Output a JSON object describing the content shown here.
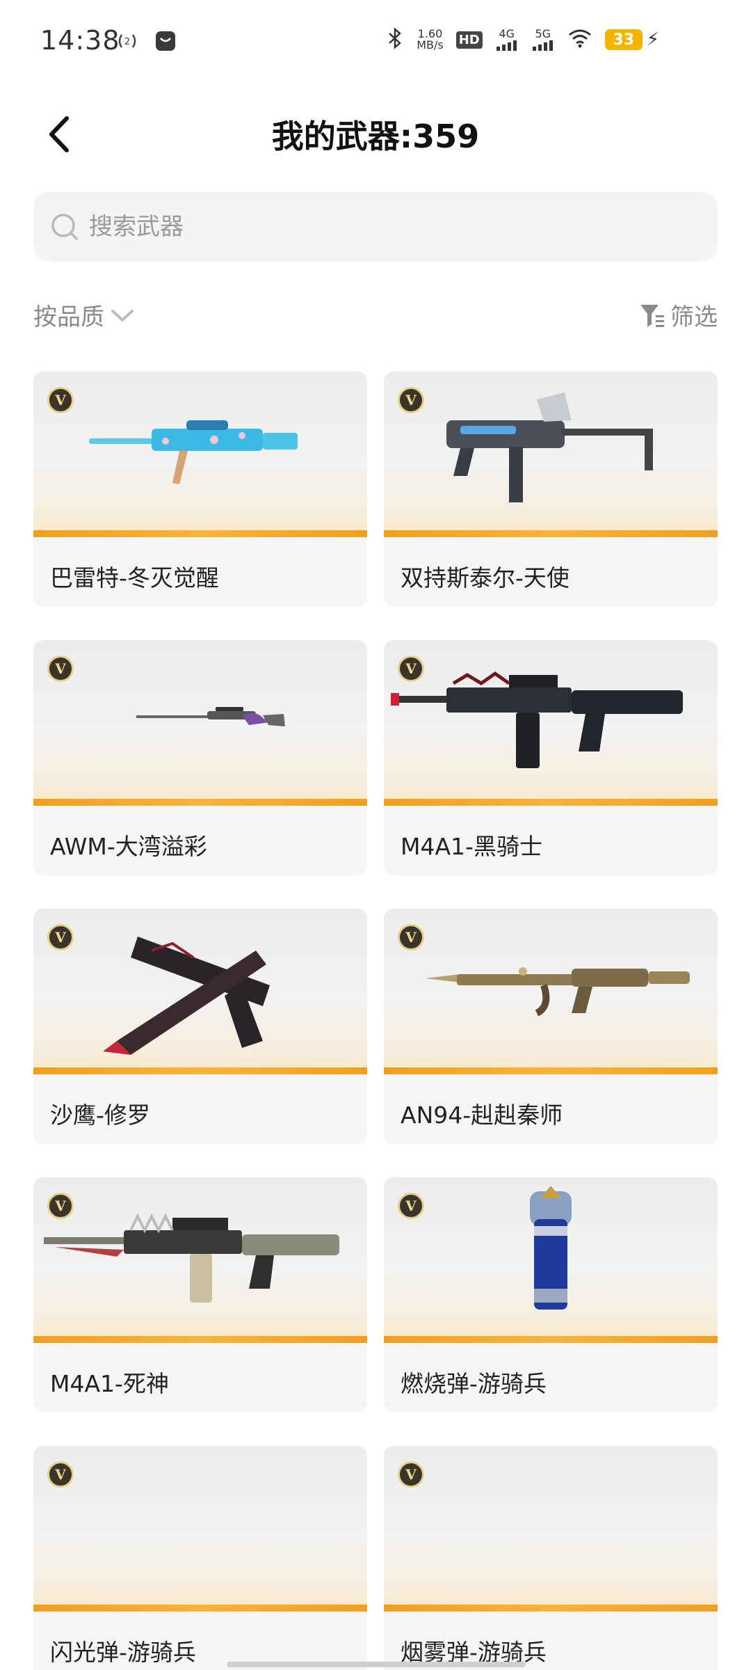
{
  "status_bar": {
    "time": "14:38",
    "net_speed_value": "1.60",
    "net_speed_unit": "MB/s",
    "hd_label": "HD",
    "network_1": "4G",
    "network_2": "5G",
    "battery_level": "33"
  },
  "header": {
    "title": "我的武器:359"
  },
  "search": {
    "placeholder": "搜索武器"
  },
  "filters": {
    "sort_label": "按品质",
    "filter_label": "筛选"
  },
  "badge_letter": "V",
  "weapons": [
    {
      "name": "巴雷特-冬灭觉醒"
    },
    {
      "name": "双持斯泰尔-天使"
    },
    {
      "name": "AWM-大湾溢彩"
    },
    {
      "name": "M4A1-黑骑士"
    },
    {
      "name": "沙鹰-修罗"
    },
    {
      "name": "AN94-赳赳秦师"
    },
    {
      "name": "M4A1-死神"
    },
    {
      "name": "燃烧弹-游骑兵"
    },
    {
      "name": "闪光弹-游骑兵"
    },
    {
      "name": "烟雾弹-游骑兵"
    }
  ]
}
